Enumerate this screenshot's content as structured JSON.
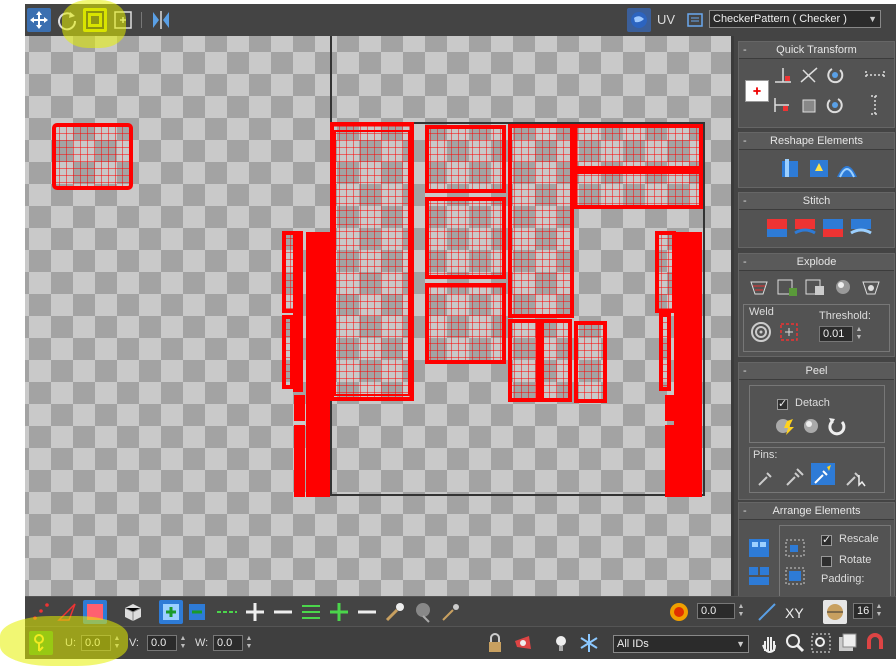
{
  "colors": {
    "panel_bg": "#444444",
    "uv_red": "#ff0000",
    "highlight": "#e6f000",
    "checker_dark": "#a3a3a3",
    "checker_light": "#c9c9c9"
  },
  "toolbar": {
    "tools": [
      {
        "name": "move-icon",
        "active": false
      },
      {
        "name": "rotate-icon",
        "active": false
      },
      {
        "name": "scale-icon",
        "active": true
      },
      {
        "name": "freeform-icon",
        "active": false
      },
      {
        "name": "mirror-icon",
        "active": false
      }
    ],
    "uv_label": "UV",
    "texture_dropdown": "CheckerPattern  ( Checker )"
  },
  "panel": {
    "quick_transform": {
      "title": "Quick Transform"
    },
    "reshape": {
      "title": "Reshape Elements"
    },
    "stitch": {
      "title": "Stitch"
    },
    "explode": {
      "title": "Explode",
      "weld_label": "Weld",
      "threshold_label": "Threshold:",
      "threshold_value": "0.01"
    },
    "peel": {
      "title": "Peel",
      "detach_label": "Detach",
      "detach_checked": true,
      "pins_label": "Pins:"
    },
    "arrange": {
      "title": "Arrange Elements",
      "rescale_label": "Rescale",
      "rescale_checked": true,
      "rotate_label": "Rotate",
      "rotate_checked": false,
      "padding_label": "Padding:"
    },
    "minus": "-"
  },
  "bottom1": {
    "soft_value": "0.0",
    "xy_label": "XY",
    "grid_value": "16"
  },
  "bottom2": {
    "u_label": "U:",
    "u_value": "0.0",
    "v_label": "V:",
    "v_value": "0.0",
    "w_label": "W:",
    "w_value": "0.0",
    "ids_dropdown": "All IDs"
  }
}
